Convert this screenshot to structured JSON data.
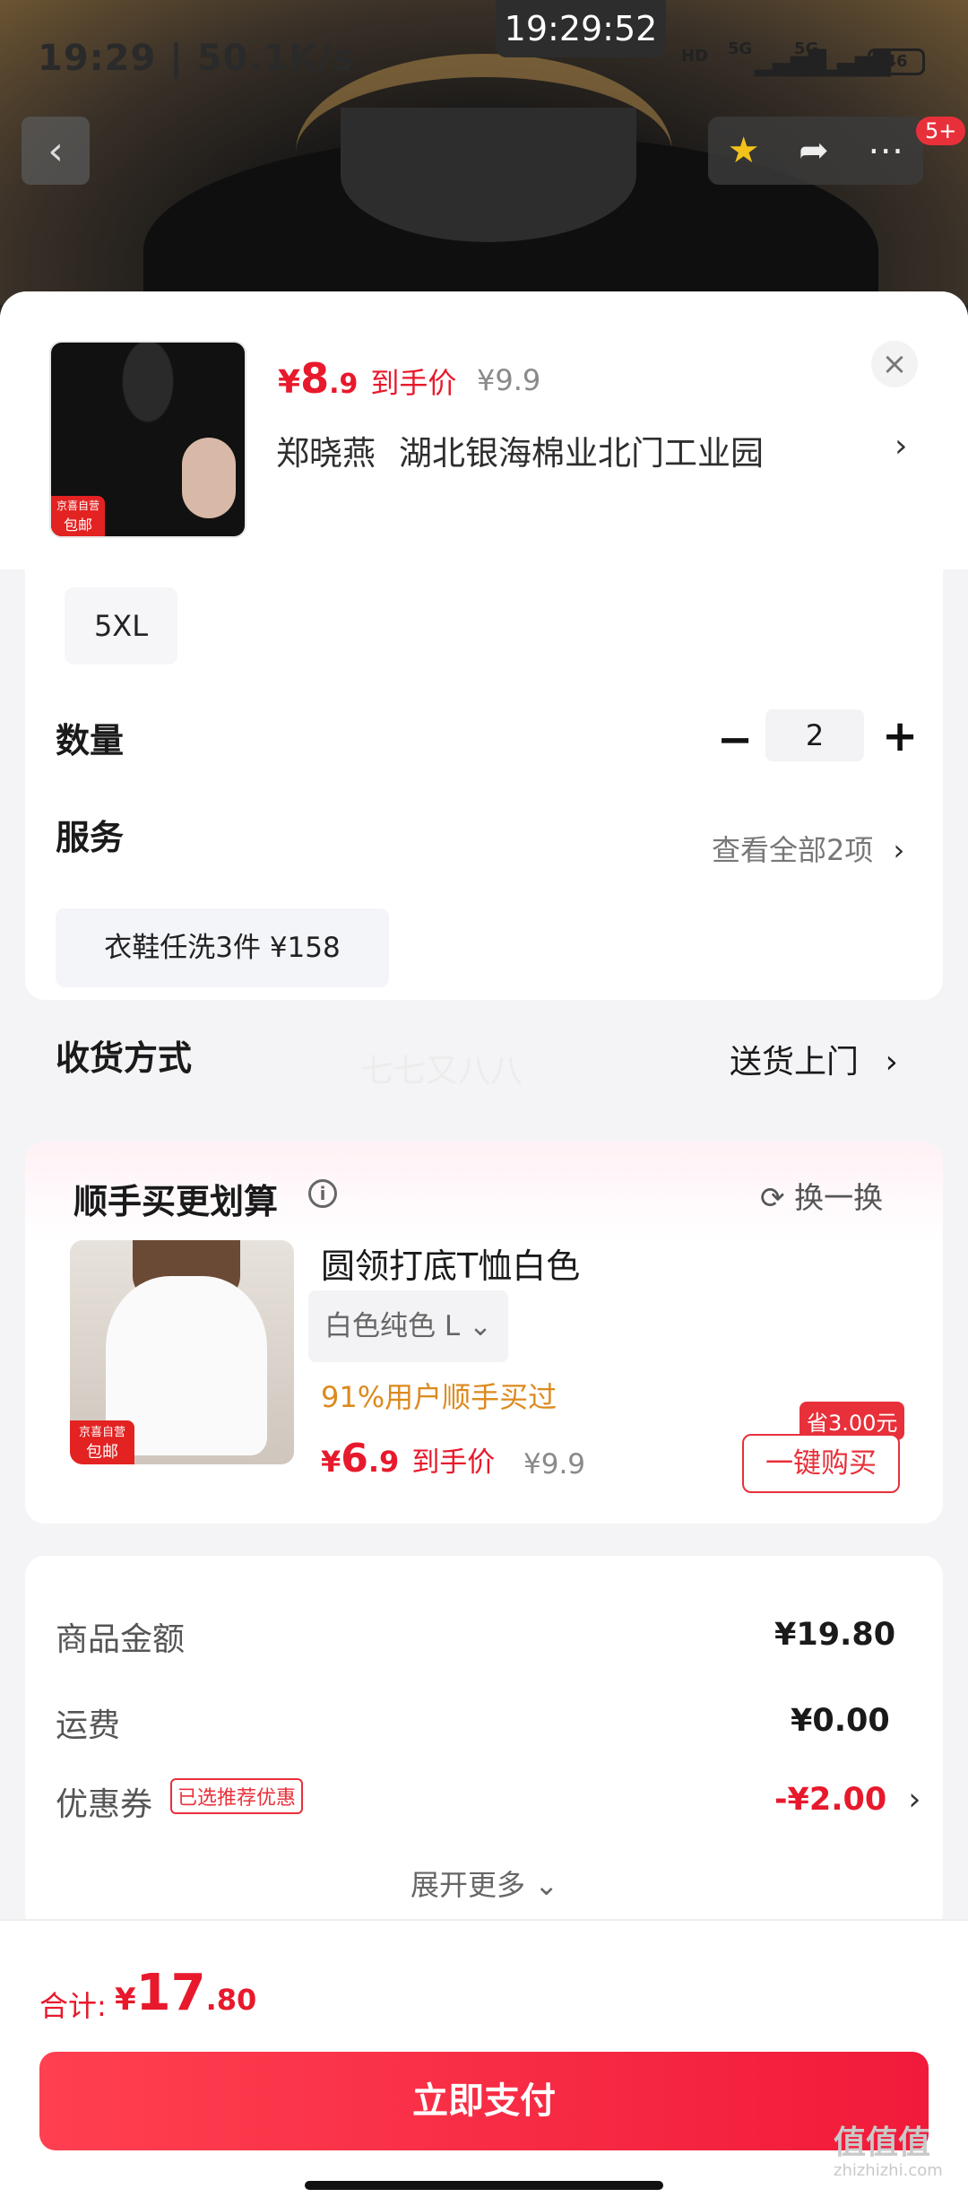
{
  "status_bar": {
    "time": "19:29 | 50.1K/s",
    "clock": "19:29:52",
    "hd": "HD",
    "net1": "5G",
    "net2": "5G",
    "battery": "46"
  },
  "top_nav": {
    "back_icon": "chevron-left-icon",
    "favorite_icon": "star-icon",
    "share_icon": "share-icon",
    "more_icon": "more-icon",
    "badge": "5+"
  },
  "product": {
    "price_symbol": "¥",
    "price_int": "8",
    "price_dec": ".9",
    "price_label": "到手价",
    "orig_price": "¥9.9",
    "thumb_tag_top": "京喜自营",
    "thumb_tag": "包邮",
    "recipient": "郑晓燕",
    "address": "湖北银海棉业北门工业园"
  },
  "options": {
    "size": "5XL",
    "qty_label": "数量",
    "qty_minus": "−",
    "qty_value": "2",
    "qty_plus": "+",
    "service_label": "服务",
    "service_more": "查看全部2项",
    "service_chip": "衣鞋任洗3件  ¥158",
    "shipping_label": "收货方式",
    "shipping_value": "送货上门",
    "watermark": "七七又八八"
  },
  "bundle": {
    "title": "顺手买更划算",
    "swap": "换一换",
    "name": "圆领打底T恤白色",
    "spec": "白色纯色  L",
    "pct": "91%用户顺手买过",
    "price_symbol": "¥",
    "price_int": "6",
    "price_dec": ".9",
    "price_label": "到手价",
    "orig_price": "¥9.9",
    "save_tag": "省3.00元",
    "buy_label": "一键购买",
    "tag_top": "京喜自营",
    "tag": "包邮"
  },
  "totals": {
    "goods_label": "商品金额",
    "goods_value": "¥19.80",
    "freight_label": "运费",
    "freight_value": "¥0.00",
    "coupon_label": "优惠券",
    "coupon_tag": "已选推荐优惠",
    "coupon_value": "-¥2.00",
    "expand": "展开更多"
  },
  "footer": {
    "total_label": "合计:",
    "total_symbol": "¥",
    "total_int": "17",
    "total_dec": ".80",
    "pay_label": "立即支付"
  },
  "corner": {
    "mark": "值值值",
    "sub": "zhizhizhi.com"
  },
  "colors": {
    "accent": "#e8192c",
    "pay_gradient_start": "#ff4050",
    "pay_gradient_end": "#f11a3a",
    "highlight": "#dc8a1e"
  }
}
